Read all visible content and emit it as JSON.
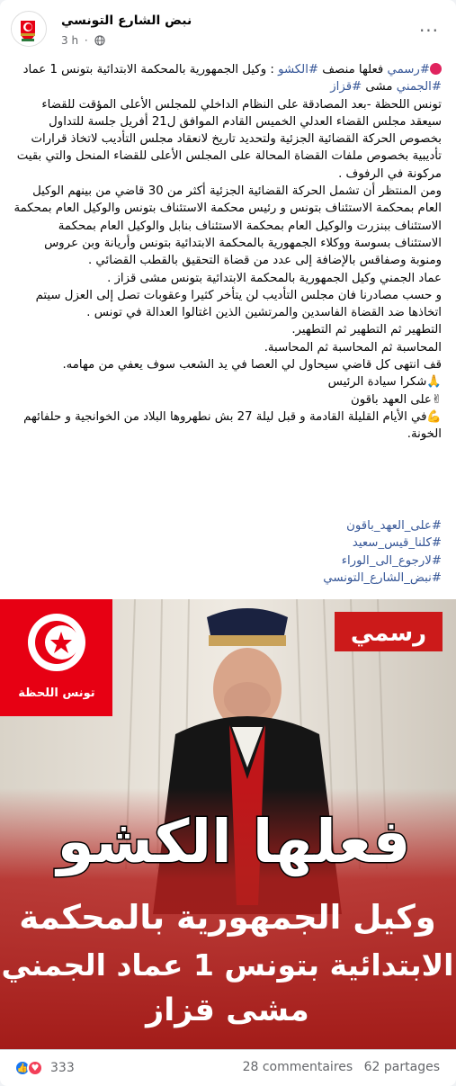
{
  "post": {
    "author": "نبض الشارع التونسي",
    "time": "3 h",
    "privacy_separator": "·",
    "more_icon": "more-options-icon",
    "paragraphs": [
      {
        "type": "headline",
        "hashtag1": "#رسمي",
        "text1": " فعلها منصف ",
        "hashtag2": "#الكشو",
        "text2": " :  وكيل الجمهورية بالمحكمة الابتدائية بتونس 1 عماد ",
        "hashtag3": "#الجمني",
        "text3": " مشى ",
        "hashtag4": "#قزاز"
      },
      {
        "type": "text",
        "text": " تونس اللحظة -بعد المصادقة على النظام الداخلي للمجلس الأعلى المؤقت للقضاء سيعقد مجلس القضاء العدلي الخميس القادم الموافق ل21 أفريل جلسة للتداول بخصوص الحركة القضائية الجزئية ولتحديد تاريخ  لانعقاد مجلس التأديب لاتخاذ قرارات تأديبية بخصوص ملفات القضاة المحالة على المجلس الأعلى للقضاء المنحل والتي بقيت مركونة في الرفوف ."
      },
      {
        "type": "text",
        "text": "ومن المنتظر أن تشمل الحركة القضائية الجزئية أكثر من 30 قاضي  من بينهم الوكيل العام بمحكمة الاستئناف بتونس و رئيس محكمة الاستئناف  بتونس والوكيل العام بمحكمة الاستئناف ببنزرت والوكيل العام بمحكمة الاستئناف بنابل والوكيل العام بمحكمة الاستئناف بسوسة ووكلاء الجمهورية بالمحكمة الابتدائية بتونس وأريانة وبن عروس ومنوبة  وصفاقس بالإضافة إلى عدد من قضاة التحقيق بالقطب القضائي ."
      },
      {
        "type": "text",
        "text": "عماد الجمني وكيل الجمهورية بالمحكمة الابتدائية بتونس مشى قزاز ."
      },
      {
        "type": "text",
        "text": "و حسب مصادرنا فان مجلس التأديب لن يتأخر كثيرا وعقوبات تصل إلى العزل سيتم اتخاذها ضد القضاة الفاسدين والمرتشين  الذين اغتالوا العدالة في تونس ."
      },
      {
        "type": "text",
        "text": "التطهير ثم التطهير ثم التطهير."
      },
      {
        "type": "text",
        "text": "المحاسبة ثم المحاسبة ثم المحاسبة."
      },
      {
        "type": "text",
        "text": "قف انتهى كل قاضي سيحاول لي العصا في يد الشعب سوف يعفي من مهامه."
      },
      {
        "type": "text",
        "text": "🙏شكرا سيادة الرئيس"
      },
      {
        "type": "text",
        "text": "✌على العهد باقون"
      },
      {
        "type": "text",
        "text": "💪في الأيام القليلة القادمة و قبل ليلة 27 بش نطهروها البلاد من الخوانجية و حلفائهم الخونة."
      }
    ],
    "hashtags": [
      "#على_العهد_باقون",
      "#كلنا_قيس_سعيد",
      "#لارجوع_الى_الوراء",
      "#نبض_الشارع_التونسي"
    ],
    "image": {
      "logo_text": "تونس اللحظة",
      "badge": "رسمي",
      "headline": "فعلها الكشو",
      "line1": "وكيل الجمهورية بالمحكمة",
      "line2": "الابتدائية بتونس 1 عماد الجمني",
      "line3": "مشى قزاز"
    },
    "reactions_count": "333",
    "comments": "28 commentaires",
    "shares": "62 partages"
  },
  "colors": {
    "link": "#385898",
    "flag_red": "#e70013",
    "image_red": "#b3201d"
  }
}
